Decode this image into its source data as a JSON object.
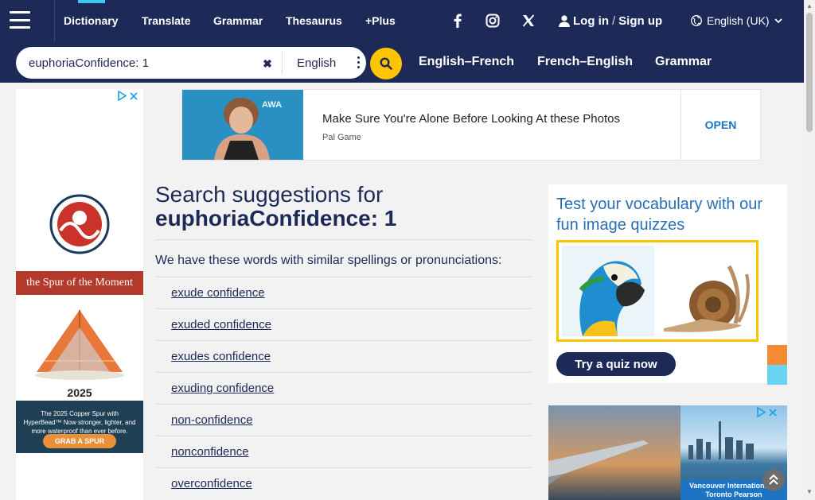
{
  "nav": {
    "links": [
      {
        "label": "Dictionary",
        "active": true
      },
      {
        "label": "Translate"
      },
      {
        "label": "Grammar"
      },
      {
        "label": "Thesaurus"
      },
      {
        "label": "+Plus"
      }
    ],
    "social_icons": [
      "facebook-icon",
      "instagram-icon",
      "x-icon"
    ],
    "login_label": "Log in",
    "login_separator": "/",
    "signup_label": "Sign up",
    "language": "English (UK)"
  },
  "search": {
    "value": "euphoriaConfidence: 1",
    "dictionary": "English",
    "subnav": [
      "English–French",
      "French–English",
      "Grammar"
    ]
  },
  "top_ad": {
    "headline": "Make Sure You're Alone Before Looking At these Photos",
    "source": "Pal Game",
    "open_label": "OPEN",
    "photo_caption": "AWA"
  },
  "left_ad": {
    "brand_text": "the Spur of the Moment",
    "year": "2025",
    "copy": "The 2025 Copper Spur with HyperBead™ Now stronger, lighter, and more waterproof than ever before.",
    "cta": "GRAB A SPUR"
  },
  "main": {
    "title_prefix": "Search suggestions for",
    "title_term": "euphoriaConfidence: 1",
    "intro": "We have these words with similar spellings or pronunciations:",
    "suggestions": [
      "exude confidence",
      "exuded confidence",
      "exudes confidence",
      "exuding confidence",
      "non-confidence",
      "nonconfidence",
      "overconfidence"
    ]
  },
  "quiz": {
    "title": "Test your vocabulary with our fun image quizzes",
    "button": "Try a quiz now"
  },
  "bottom_ad": {
    "caption": "Vancouver International ✈ Toronto Pearson"
  },
  "colors": {
    "navy": "#1d2a57",
    "accent_yellow": "#fec400",
    "accent_cyan": "#41c7ef",
    "side_orange": "#f58a34",
    "side_cyan": "#6ad3f1"
  }
}
